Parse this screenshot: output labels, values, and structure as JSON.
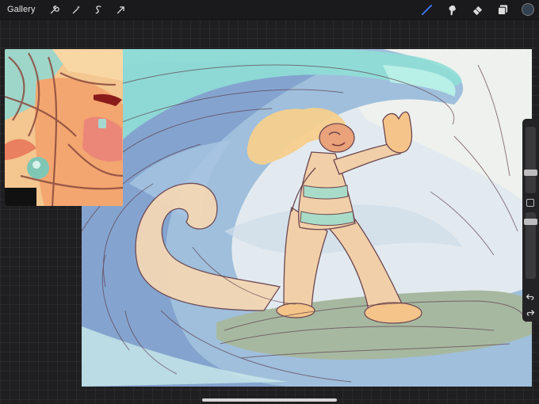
{
  "topbar": {
    "gallery_label": "Gallery",
    "left_tools": [
      "wrench-icon",
      "magic-wand-icon",
      "selection-icon",
      "transform-arrow-icon"
    ],
    "right_tools": [
      "brush-icon",
      "smudge-icon",
      "eraser-icon",
      "layers-icon"
    ],
    "active_tool": "brush-icon",
    "current_color": "#32414d",
    "active_tool_color": "#3d7bf5"
  },
  "sidebar": {
    "brush_size_level": 0.36,
    "opacity_level": 0.74,
    "icons": [
      "modify-square",
      "undo-arrow-icon",
      "redo-arrow-icon"
    ]
  },
  "canvas": {
    "subject": "sketch-surfer-on-wave",
    "palette": {
      "sky": "#dfe8ee",
      "wave_blue": "#8fb3d6",
      "wave_deep": "#6f8fc0",
      "wave_teal": "#8fded6",
      "board": "#a9b7a0",
      "skin": "#f3d2ae",
      "hair": "#f6cf8c",
      "sketch": "#5b3a45"
    }
  },
  "reference": {
    "subject": "zoomed-face-detail"
  }
}
